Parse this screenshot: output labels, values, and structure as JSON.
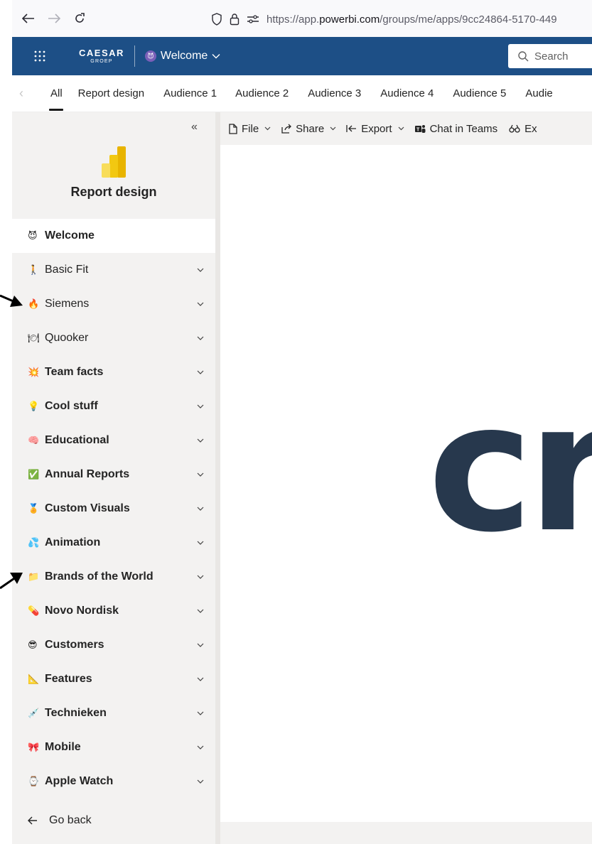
{
  "browser": {
    "url_prefix": "https://app.",
    "url_domain": "powerbi.com",
    "url_suffix": "/groups/me/apps/9cc24864-5170-449"
  },
  "header": {
    "brand_line1": "CAESAR",
    "brand_line2": "GROEP",
    "app_name": "Welcome",
    "search_placeholder": "Search"
  },
  "tabs": [
    {
      "label": "All"
    },
    {
      "label": "Report design"
    },
    {
      "label": "Audience 1"
    },
    {
      "label": "Audience 2"
    },
    {
      "label": "Audience 3"
    },
    {
      "label": "Audience 4"
    },
    {
      "label": "Audience 5"
    },
    {
      "label": "Audie"
    }
  ],
  "sidebar": {
    "title": "Report design",
    "items": [
      {
        "label": "Welcome",
        "emoji": "😈"
      },
      {
        "label": "Basic Fit",
        "emoji": "🚶"
      },
      {
        "label": "Siemens",
        "emoji": "🔥"
      },
      {
        "label": "Quooker",
        "emoji": "🍽"
      },
      {
        "label": "Team facts",
        "emoji": "💥"
      },
      {
        "label": "Cool stuff",
        "emoji": "💡"
      },
      {
        "label": "Educational",
        "emoji": "🧠"
      },
      {
        "label": "Annual Reports",
        "emoji": "✅"
      },
      {
        "label": "Custom Visuals",
        "emoji": "🏅"
      },
      {
        "label": "Animation",
        "emoji": "💦"
      },
      {
        "label": "Brands of the World",
        "emoji": "📁"
      },
      {
        "label": "Novo Nordisk",
        "emoji": "💊"
      },
      {
        "label": "Customers",
        "emoji": "😎"
      },
      {
        "label": "Features",
        "emoji": "📐"
      },
      {
        "label": "Technieken",
        "emoji": "💉"
      },
      {
        "label": "Mobile",
        "emoji": "🎀"
      },
      {
        "label": "Apple Watch",
        "emoji": "⌚"
      }
    ],
    "go_back": "Go back"
  },
  "toolbar": {
    "file": "File",
    "share": "Share",
    "export": "Export",
    "chat": "Chat in Teams",
    "ex": "Ex"
  },
  "canvas": {
    "big_text": "cr"
  },
  "colors": {
    "header_bg": "#1d4f86",
    "sidebar_bg": "#f3f2f1",
    "canvas_text": "#27384d"
  }
}
